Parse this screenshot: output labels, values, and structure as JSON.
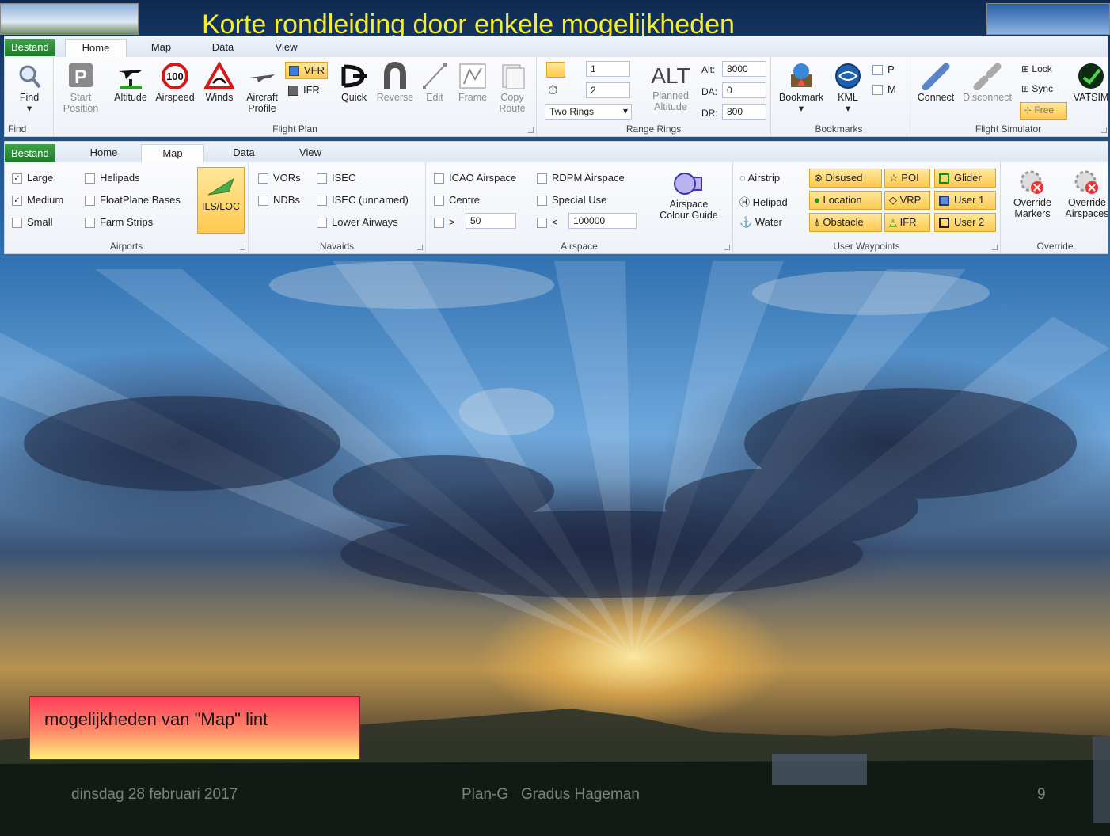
{
  "slide": {
    "title": "Korte rondleiding door enkele mogelijkheden",
    "note": "mogelijkheden van \"Map\" lint",
    "footer": {
      "date": "dinsdag 28 februari 2017",
      "center": "Plan-G   Gradus Hageman",
      "page": "9"
    },
    "colors": {
      "title": "#f4ef2a",
      "note_top": "#ff3d5a",
      "note_bottom": "#fff07a",
      "file_tab": "#2a8a36",
      "highlight": "#ffd266"
    }
  },
  "home_ribbon": {
    "tabs": {
      "file": "Bestand",
      "home": "Home",
      "map": "Map",
      "data": "Data",
      "view": "View"
    },
    "find": {
      "btn": "Find",
      "group": "Find"
    },
    "flight_plan": {
      "start": "Start\nPosition",
      "altitude": "Altitude",
      "airspeed": "Airspeed",
      "winds": "Winds",
      "aircraft": "Aircraft\nProfile",
      "vfr": "VFR",
      "ifr": "IFR",
      "quick": "Quick",
      "reverse": "Reverse",
      "edit": "Edit",
      "frame": "Frame",
      "copy": "Copy\nRoute",
      "group": "Flight Plan",
      "speed_sign": "100"
    },
    "range_rings": {
      "ring1": "1",
      "ring2": "2",
      "select": "Two Rings",
      "alt_big": "ALT",
      "planned": "Planned\nAltitude",
      "alt_label": "Alt:",
      "alt_val": "8000",
      "da_label": "DA:",
      "da_val": "0",
      "dr_label": "DR:",
      "dr_val": "800",
      "group": "Range Rings"
    },
    "bookmarks": {
      "bookmark": "Bookmark",
      "kml": "KML",
      "p": "P",
      "m": "M",
      "group": "Bookmarks"
    },
    "flight_sim": {
      "connect": "Connect",
      "disconnect": "Disconnect",
      "lock": "Lock",
      "sync": "Sync",
      "free": "Free",
      "vatsim": "VATSIM",
      "group": "Flight Simulator"
    }
  },
  "map_ribbon": {
    "tabs": {
      "file": "Bestand",
      "home": "Home",
      "map": "Map",
      "data": "Data",
      "view": "View"
    },
    "airports": {
      "large": "Large",
      "medium": "Medium",
      "small": "Small",
      "helipads": "Helipads",
      "floatplane": "FloatPlane Bases",
      "farm": "Farm Strips",
      "ils": "ILS/LOC",
      "group": "Airports"
    },
    "navaids": {
      "vors": "VORs",
      "ndbs": "NDBs",
      "isec": "ISEC",
      "isec_unnamed": "ISEC (unnamed)",
      "lower_airways": "Lower Airways",
      "group": "Navaids"
    },
    "airspace": {
      "icao": "ICAO Airspace",
      "centre": "Centre",
      "gt": ">",
      "gt_val": "50",
      "rdpm": "RDPM Airspace",
      "special": "Special Use",
      "lt": "<",
      "lt_val": "100000",
      "colour_guide": "Airspace\nColour Guide",
      "group": "Airspace"
    },
    "user_waypoints": {
      "airstrip": "Airstrip",
      "helipad": "Helipad",
      "water": "Water",
      "disused": "Disused",
      "location": "Location",
      "obstacle": "Obstacle",
      "poi": "POI",
      "vrp": "VRP",
      "ifr": "IFR",
      "glider": "Glider",
      "user1": "User 1",
      "user2": "User 2",
      "group": "User Waypoints"
    },
    "override": {
      "markers": "Override\nMarkers",
      "airspaces": "Override\nAirspaces",
      "group": "Override"
    }
  }
}
